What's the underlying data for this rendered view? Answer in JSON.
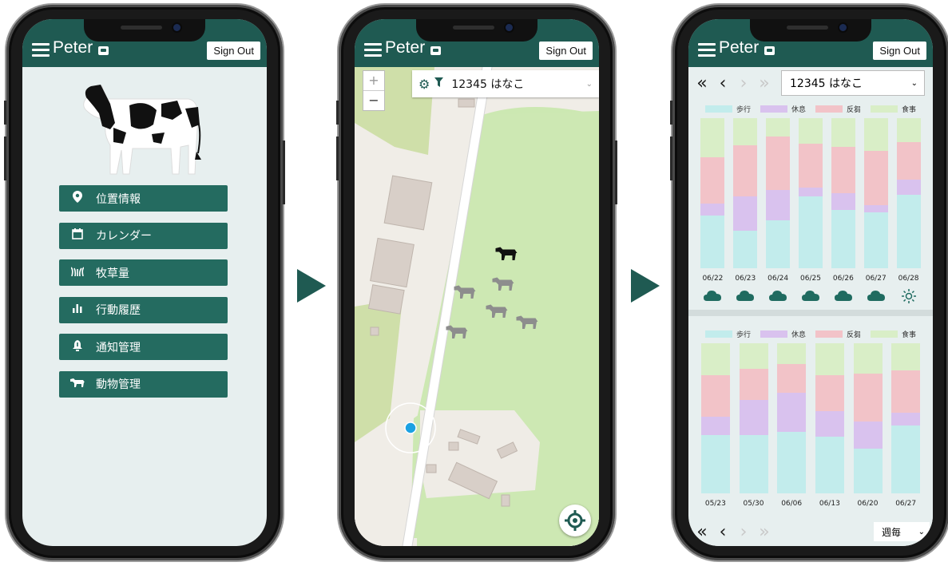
{
  "app": {
    "title": "Peter",
    "sign_out": "Sign Out",
    "brand_color": "#1f5a52"
  },
  "screen1": {
    "menu": [
      {
        "label": "位置情報",
        "icon": "map-pin-icon"
      },
      {
        "label": "カレンダー",
        "icon": "calendar-icon"
      },
      {
        "label": "牧草量",
        "icon": "grass-icon"
      },
      {
        "label": "行動履歴",
        "icon": "bar-chart-icon"
      },
      {
        "label": "通知管理",
        "icon": "bell-icon"
      },
      {
        "label": "動物管理",
        "icon": "cow-icon"
      }
    ]
  },
  "screen2": {
    "animal_select": "12345 はなこ",
    "zoom_in": "+",
    "zoom_out": "−"
  },
  "screen3": {
    "animal_select": "12345 はなこ",
    "period_select": "週毎",
    "legend": [
      "歩行",
      "休息",
      "反芻",
      "食事"
    ],
    "colors": {
      "walk": "#c2ecec",
      "rest": "#d9c2ee",
      "rumination": "#f2c3c8",
      "eat": "#d9eec7"
    },
    "daily_chart": {
      "type": "bar",
      "categories": [
        "06/22",
        "06/23",
        "06/24",
        "06/25",
        "06/26",
        "06/27",
        "06/28"
      ],
      "series": [
        {
          "name": "歩行",
          "values": [
            35,
            25,
            32,
            48,
            39,
            37,
            49
          ]
        },
        {
          "name": "休息",
          "values": [
            8,
            23,
            20,
            6,
            11,
            5,
            10
          ]
        },
        {
          "name": "反芻",
          "values": [
            31,
            34,
            36,
            29,
            31,
            36,
            25
          ]
        },
        {
          "name": "食事",
          "values": [
            26,
            18,
            12,
            17,
            19,
            22,
            16
          ]
        }
      ],
      "weather": [
        "cloud",
        "cloud",
        "cloud",
        "cloud",
        "cloud",
        "cloud",
        "sun"
      ]
    },
    "weekly_chart": {
      "type": "bar",
      "categories": [
        "05/23",
        "05/30",
        "06/06",
        "06/13",
        "06/20",
        "06/27"
      ],
      "series": [
        {
          "name": "歩行",
          "values": [
            39,
            39,
            41,
            38,
            30,
            45
          ]
        },
        {
          "name": "休息",
          "values": [
            12,
            23,
            26,
            17,
            18,
            9
          ]
        },
        {
          "name": "反芻",
          "values": [
            28,
            21,
            19,
            24,
            32,
            28
          ]
        },
        {
          "name": "食事",
          "values": [
            21,
            17,
            14,
            21,
            20,
            18
          ]
        }
      ]
    }
  }
}
